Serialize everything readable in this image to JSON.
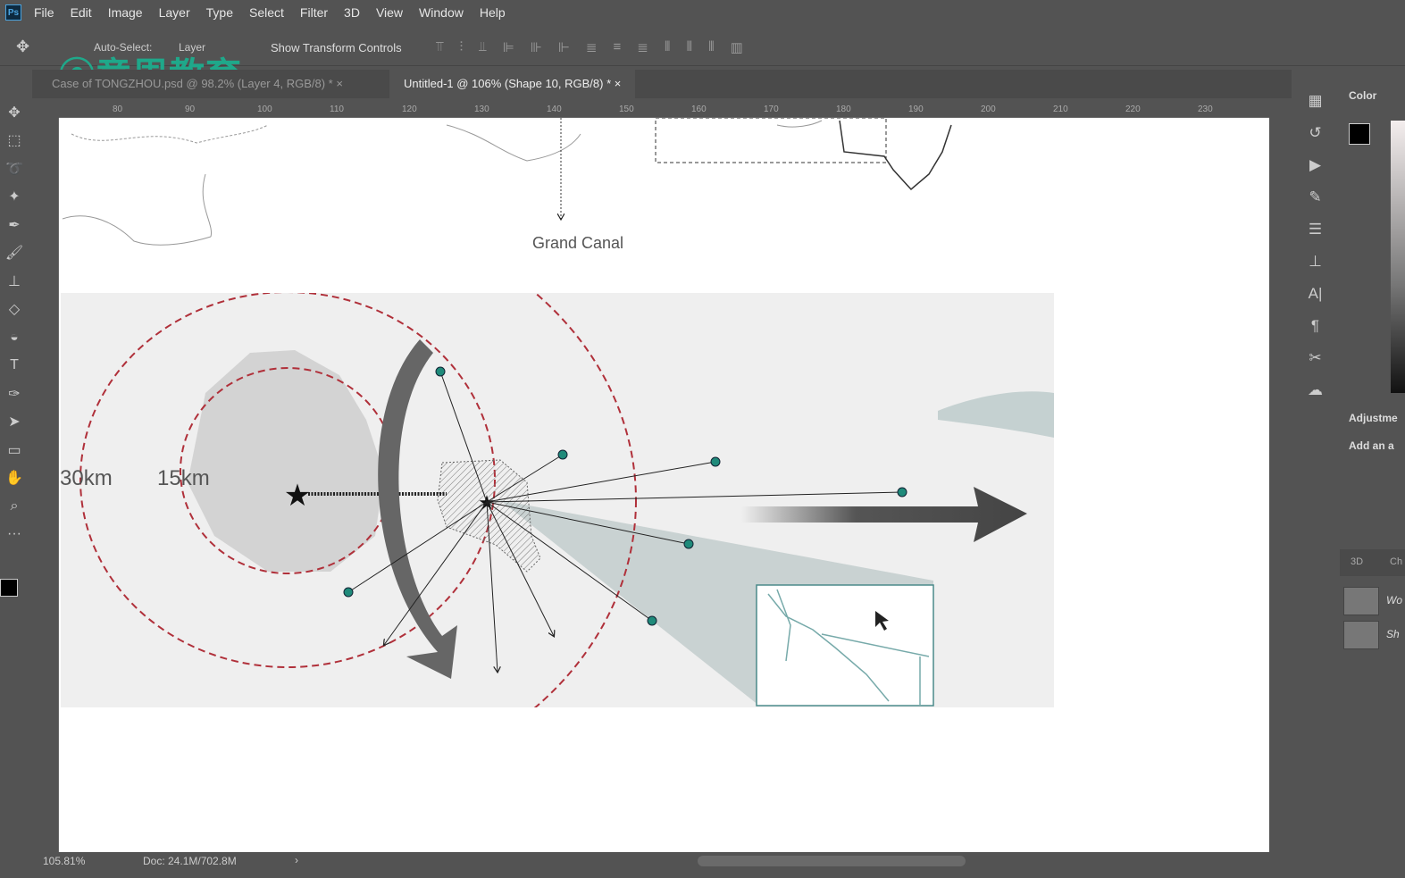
{
  "app": {
    "logo": "Ps",
    "watermark": "意周教育"
  },
  "menu": [
    "File",
    "Edit",
    "Image",
    "Layer",
    "Type",
    "Select",
    "Filter",
    "3D",
    "View",
    "Window",
    "Help"
  ],
  "options": {
    "auto_select": "Auto-Select:",
    "layer_select": "Layer",
    "show_transform": "Show Transform Controls"
  },
  "tabs": [
    {
      "label": "Case of TONGZHOU.psd @ 98.2% (Layer 4, RGB/8) *",
      "active": false
    },
    {
      "label": "Untitled-1 @ 106% (Shape 10, RGB/8) *",
      "active": true
    }
  ],
  "ruler_ticks": [
    "80",
    "90",
    "100",
    "110",
    "120",
    "130",
    "140",
    "150",
    "160",
    "170",
    "180",
    "190",
    "200",
    "210",
    "220",
    "230"
  ],
  "tools": [
    "move-icon",
    "marquee-icon",
    "lasso-icon",
    "magic-wand-icon",
    "eyedropper-icon",
    "brush-icon",
    "stamp-icon",
    "eraser-icon",
    "bucket-icon",
    "type-icon",
    "pen-icon",
    "path-select-icon",
    "rectangle-icon",
    "hand-icon",
    "zoom-icon",
    "more-icon"
  ],
  "canvas": {
    "label_grand_canal": "Grand Canal",
    "label_30km": "30km",
    "label_15km": "15km"
  },
  "colors": {
    "teal": "#1f8a7a",
    "red_dash": "#b0303a",
    "map_gray": "#d8d8d8"
  },
  "status": {
    "zoom": "105.81%",
    "doc": "Doc: 24.1M/702.8M"
  },
  "panel": {
    "color_title": "Color",
    "adjustments_title": "Adjustme",
    "adjustments_hint": "Add an a",
    "tab_3d": "3D",
    "tab_ch": "Ch",
    "layer1": "Wo",
    "layer2": "Sh"
  }
}
